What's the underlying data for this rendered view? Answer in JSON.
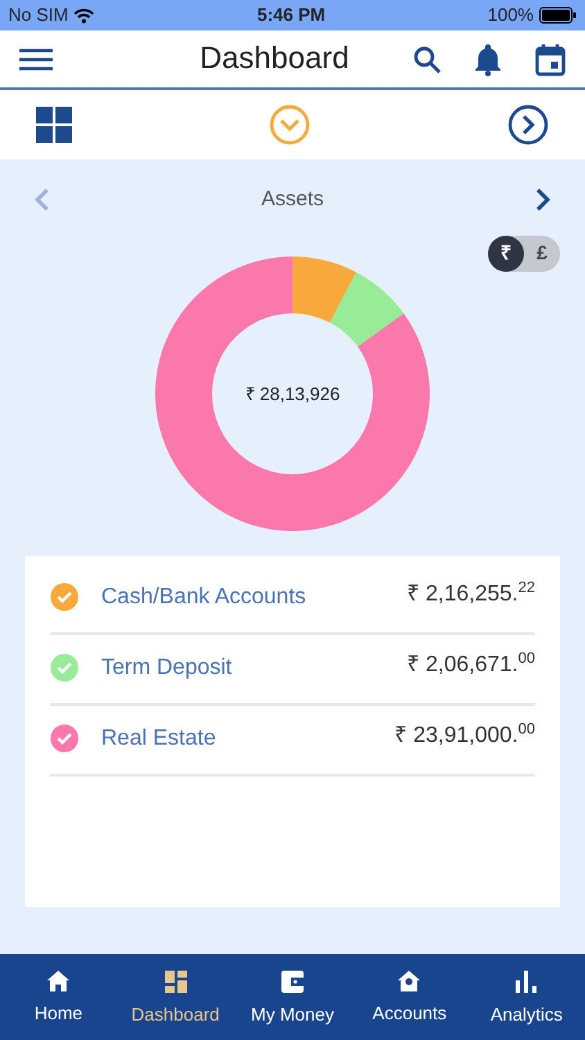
{
  "status_bar": {
    "carrier": "No SIM",
    "time": "5:46 PM",
    "battery": "100%"
  },
  "header": {
    "title": "Dashboard"
  },
  "assets": {
    "title": "Assets",
    "currency_toggle": [
      {
        "label": "₹",
        "selected": true
      },
      {
        "label": "£",
        "selected": false
      }
    ],
    "total": "₹ 28,13,926",
    "chart_data": {
      "type": "donut",
      "values": [
        7.69,
        7.34,
        84.97
      ]
    },
    "items": [
      {
        "name": "Cash/Bank Accounts",
        "amount": "₹ 2,16,255.$^{22}$",
        "color": "#f9a93c",
        "checked": true
      },
      {
        "name": "Term Deposit",
        "amount": "₹ 2,06,671.$^{00}$",
        "color": "#98ec98",
        "checked": true
      },
      {
        "name": "Real Estate",
        "amount": "₹ 23,91,000.$^{00}$",
        "color": "#fb78ac",
        "checked": true
      }
    ]
  },
  "tab_bar": [
    {
      "label": "Home",
      "selected": false
    },
    {
      "label": "Dashboard",
      "selected": true
    },
    {
      "label": "My Money",
      "selected": false
    },
    {
      "label": "Accounts",
      "selected": false
    },
    {
      "label": "Analytics",
      "selected": false
    }
  ]
}
